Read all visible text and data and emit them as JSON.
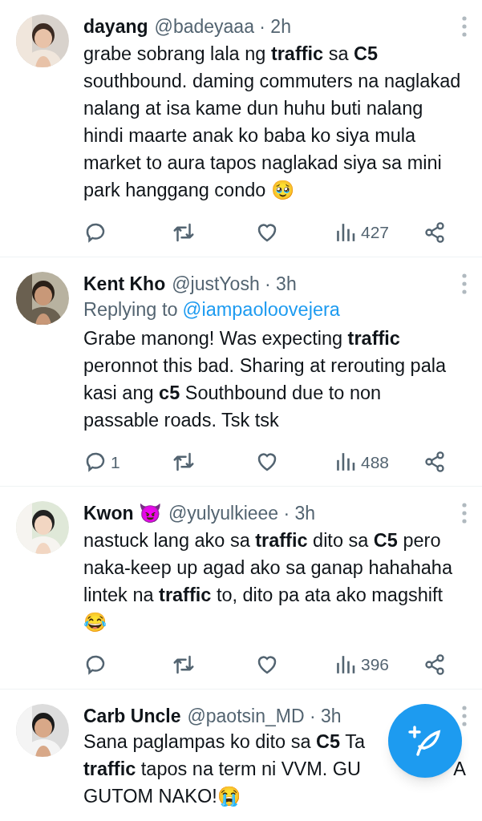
{
  "tweets": [
    {
      "name": "dayang",
      "handle": "@badeyaaa · 2h",
      "text": "grabe sobrang lala ng **traffic** sa **C5** southbound. daming commuters na naglakad nalang at isa kame dun huhu buti nalang hindi maarte anak ko baba ko siya mula market to aura tapos naglakad siya sa mini park hanggang condo 🥹",
      "views": "427"
    },
    {
      "name": "Kent Kho",
      "handle": "@justYosh · 3h",
      "replying_label": "Replying to",
      "replying_to": "@iampaoloovejera",
      "text": "Grabe manong! Was expecting **traffic** peronnot this bad. Sharing at rerouting pala kasi ang **c5** Southbound due to non passable roads. Tsk tsk",
      "replies": "1",
      "views": "488"
    },
    {
      "name": "Kwon 😈",
      "handle": "@yulyulkieee · 3h",
      "text": "nastuck lang ako sa **traffic** dito sa **C5** pero naka-keep up agad ako sa ganap hahahaha lintek na **traffic** to, dito pa ata ako magshift 😂",
      "views": "396"
    },
    {
      "name": "Carb Uncle",
      "handle": "@paotsin_MD · 3h",
      "lines": [
        {
          "text": "Sana paglampas ko dito sa **C5** Ta"
        },
        {
          "text": "**traffic** tapos na term ni VVM. GU",
          "tail": "A"
        },
        {
          "text": "GUTOM NAKO!😭"
        }
      ]
    }
  ]
}
